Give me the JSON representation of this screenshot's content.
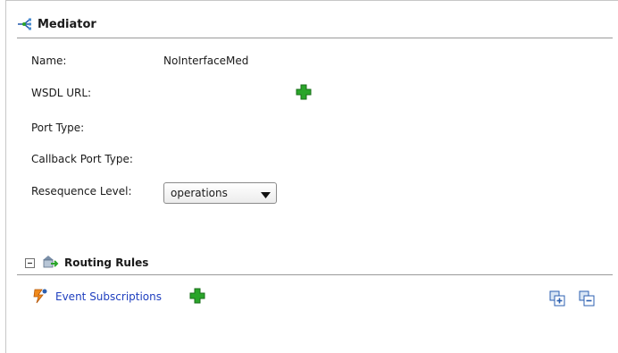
{
  "mediator": {
    "title": "Mediator",
    "fields": {
      "name_label": "Name:",
      "name_value": "NoInterfaceMed",
      "wsdl_label": "WSDL URL:",
      "port_type_label": "Port Type:",
      "callback_label": "Callback Port Type:",
      "resequence_label": "Resequence Level:",
      "resequence_value": "operations"
    }
  },
  "routing": {
    "title": "Routing Rules",
    "event_subscriptions_label": "Event Subscriptions"
  },
  "colors": {
    "accent_green": "#2aa52a",
    "link_blue": "#1f3fbf",
    "rule_gray": "#9a9a9a"
  },
  "icons": [
    "mediator-icon",
    "add-icon",
    "collapse-icon",
    "routing-rules-icon",
    "event-icon",
    "expand-all-icon",
    "collapse-all-icon"
  ]
}
